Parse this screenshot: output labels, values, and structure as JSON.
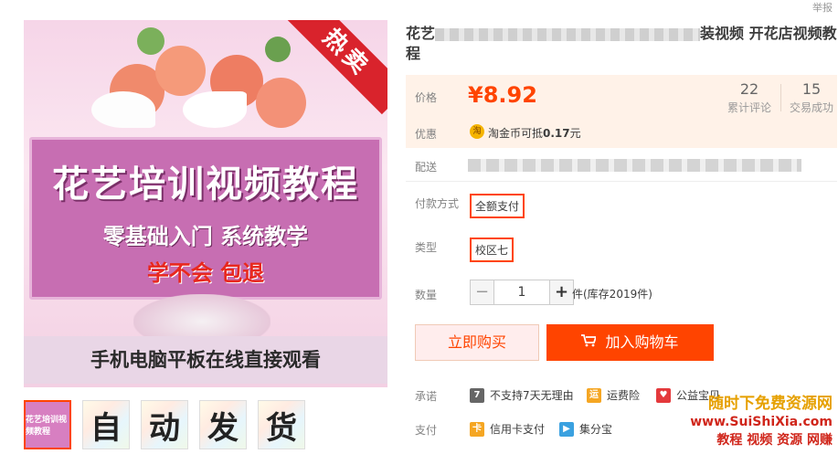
{
  "report_link": "举报",
  "main_image": {
    "hot_label": "热卖",
    "banner_title": "花艺培训视频教程",
    "banner_subtitle": "零基础入门 系统教学",
    "banner_guarantee": "学不会 包退",
    "bottom_caption": "手机电脑平板在线直接观看"
  },
  "thumbnails": {
    "first_caption": "花艺培训视频教程",
    "chars": [
      "自",
      "动",
      "发",
      "货"
    ]
  },
  "product": {
    "title_start": "花艺",
    "title_end": "装视频 开花店视频教程"
  },
  "price_section": {
    "price_label": "价格",
    "price": "¥8.92",
    "reviews_count": "22",
    "reviews_label": "累计评论",
    "sales_count": "15",
    "sales_label": "交易成功",
    "promo_label": "优惠",
    "coin_icon_text": "淘",
    "coin_text_prefix": "淘金币可抵",
    "coin_amount": "0.17",
    "coin_text_suffix": "元"
  },
  "shipping_label": "配送",
  "payment_method": {
    "label": "付款方式",
    "option": "全额支付"
  },
  "type_option": {
    "label": "类型",
    "option": "校区七"
  },
  "quantity": {
    "label": "数量",
    "value": "1",
    "minus": "−",
    "plus": "+",
    "unit_stock": "件(库存2019件)"
  },
  "actions": {
    "buy_now": "立即购买",
    "add_to_cart": "加入购物车",
    "cart_icon": "shopping-cart-icon"
  },
  "promises": {
    "label": "承诺",
    "items": [
      {
        "icon": "7",
        "text": "不支持7天无理由"
      },
      {
        "icon": "运",
        "text": "运费险"
      },
      {
        "icon": "♥",
        "text": "公益宝贝"
      }
    ]
  },
  "payment": {
    "label": "支付",
    "items": [
      {
        "icon": "卡",
        "text": "信用卡支付"
      },
      {
        "icon": "▶",
        "text": "集分宝"
      }
    ]
  },
  "watermark": {
    "line1": "随时下免费资源网",
    "line2": "www.SuiShiXia.com",
    "line3": "教程 视频 资源 网赚"
  },
  "colors": {
    "accent": "#ff4400",
    "price_bg": "#fff2e8",
    "buy_now_bg": "#ffeded"
  }
}
